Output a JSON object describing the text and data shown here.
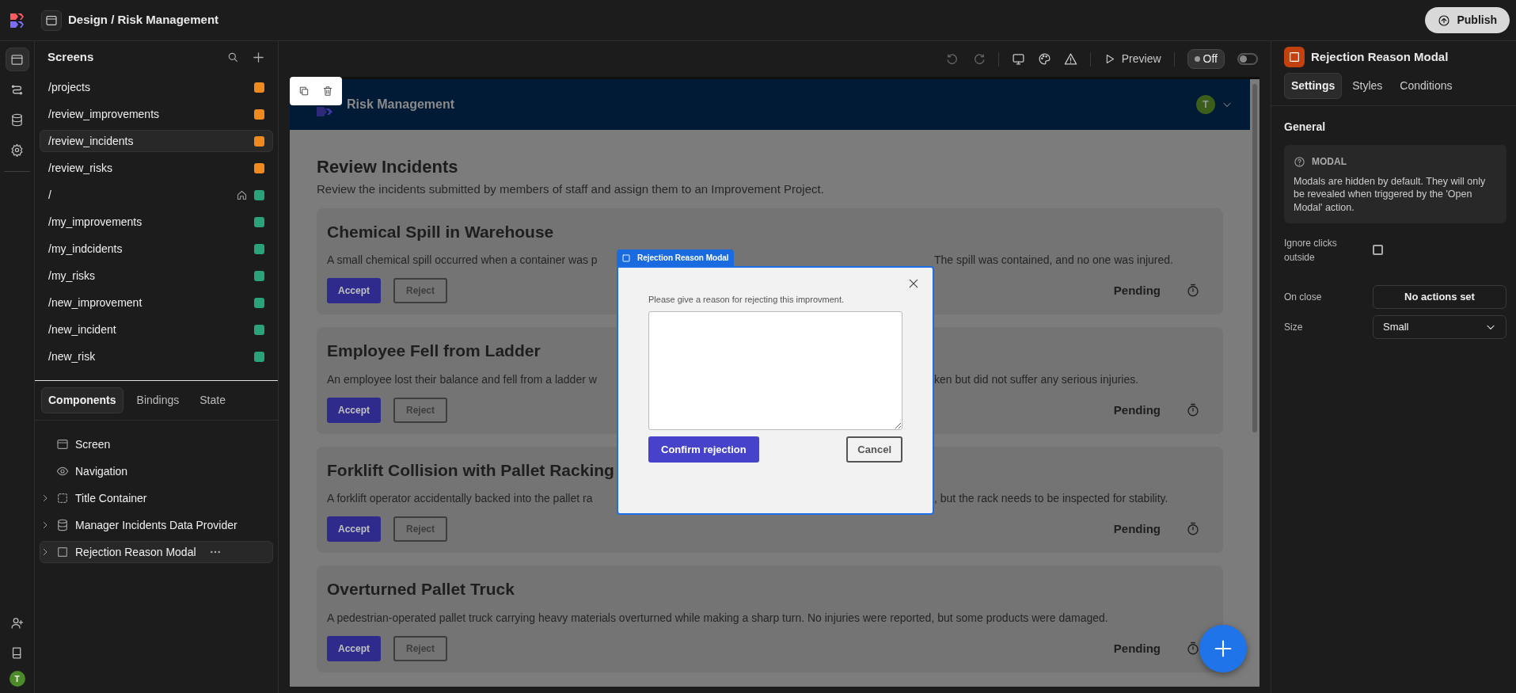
{
  "app_bar": {
    "breadcrumb": "Design / Risk Management",
    "publish_label": "Publish"
  },
  "rail": {
    "items": [
      {
        "selected": true
      },
      {
        "selected": false
      },
      {
        "selected": false
      },
      {
        "selected": false
      }
    ],
    "avatar": "T"
  },
  "screens_panel": {
    "title": "Screens",
    "items": [
      {
        "path": "/projects",
        "color": "#f0891e",
        "home": false,
        "selected": false
      },
      {
        "path": "/review_improvements",
        "color": "#f0891e",
        "home": false,
        "selected": false
      },
      {
        "path": "/review_incidents",
        "color": "#f0891e",
        "home": false,
        "selected": true
      },
      {
        "path": "/review_risks",
        "color": "#f0891e",
        "home": false,
        "selected": false
      },
      {
        "path": "/",
        "color": "#2aa37a",
        "home": true,
        "selected": false
      },
      {
        "path": "/my_improvements",
        "color": "#2aa37a",
        "home": false,
        "selected": false
      },
      {
        "path": "/my_indcidents",
        "color": "#2aa37a",
        "home": false,
        "selected": false
      },
      {
        "path": "/my_risks",
        "color": "#2aa37a",
        "home": false,
        "selected": false
      },
      {
        "path": "/new_improvement",
        "color": "#2aa37a",
        "home": false,
        "selected": false
      },
      {
        "path": "/new_incident",
        "color": "#2aa37a",
        "home": false,
        "selected": false
      },
      {
        "path": "/new_risk",
        "color": "#2aa37a",
        "home": false,
        "selected": false
      }
    ]
  },
  "panel_tabs": [
    {
      "label": "Components",
      "selected": true
    },
    {
      "label": "Bindings",
      "selected": false
    },
    {
      "label": "State",
      "selected": false
    }
  ],
  "components": [
    {
      "label": "Screen",
      "kind": "screen",
      "has_children": false,
      "selected": false
    },
    {
      "label": "Navigation",
      "kind": "navigation",
      "has_children": false,
      "selected": false
    },
    {
      "label": "Title Container",
      "kind": "container",
      "has_children": true,
      "selected": false
    },
    {
      "label": "Manager Incidents Data Provider",
      "kind": "data",
      "has_children": true,
      "selected": false
    },
    {
      "label": "Rejection Reason Modal",
      "kind": "modal",
      "has_children": true,
      "selected": true
    }
  ],
  "toolbar": {
    "preview_label": "Preview",
    "mode_label": "Off",
    "switch_on": false
  },
  "preview": {
    "app_title": "Risk Management",
    "avatar": "T",
    "heading": "Review Incidents",
    "intro": "Review the incidents submitted by members of staff and assign them to an Improvement Project.",
    "cards": [
      {
        "title": "Chemical Spill in Warehouse",
        "desc_left": "A small chemical spill occurred when a container was p",
        "desc_right": "The spill was contained, and no one was injured.",
        "accept": "Accept",
        "reject": "Reject",
        "status": "Pending"
      },
      {
        "title": "Employee Fell from Ladder",
        "desc_left": "An employee lost their balance and fell from a ladder w",
        "desc_right": "ken but did not suffer any serious injuries.",
        "accept": "Accept",
        "reject": "Reject",
        "status": "Pending"
      },
      {
        "title": "Forklift Collision with Pallet Racking",
        "desc_left": "A forklift operator accidentally backed into the pallet ra",
        "desc_right": ", but the rack needs to be inspected for stability.",
        "accept": "Accept",
        "reject": "Reject",
        "status": "Pending"
      },
      {
        "title": "Overturned Pallet Truck",
        "desc_left": "A pedestrian-operated pallet truck carrying heavy materials overturned while making a sharp turn. No injuries were reported, but some products were damaged.",
        "accept": "Accept",
        "reject": "Reject",
        "status": "Pending"
      }
    ]
  },
  "modal": {
    "tag": "Rejection Reason Modal",
    "prompt": "Please give a reason for rejecting this improvment.",
    "confirm": "Confirm rejection",
    "cancel": "Cancel"
  },
  "inspector": {
    "title": "Rejection Reason Modal",
    "tabs": [
      {
        "label": "Settings",
        "selected": true
      },
      {
        "label": "Styles",
        "selected": false
      },
      {
        "label": "Conditions",
        "selected": false
      }
    ],
    "section": "General",
    "info_title": "MODAL",
    "info_text": "Modals are hidden by default. They will only be revealed when triggered by the 'Open Modal' action.",
    "ignore_label": "Ignore clicks outside",
    "ignore_checked": false,
    "on_close_label": "On close",
    "on_close_value": "No actions set",
    "size_label": "Size",
    "size_value": "Small"
  }
}
